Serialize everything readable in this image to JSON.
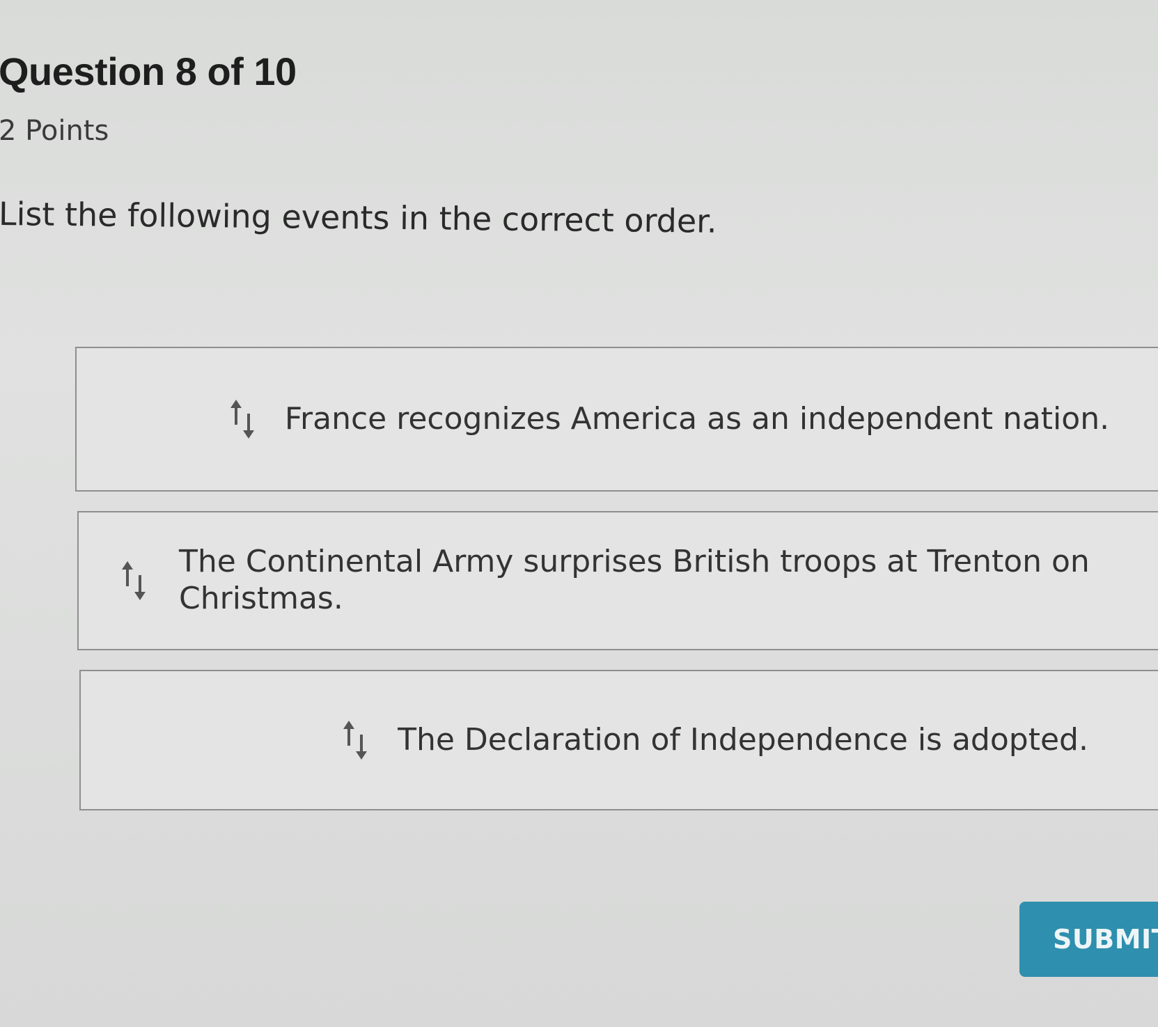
{
  "question": {
    "title": "Question 8 of 10",
    "points": "2 Points",
    "prompt": "List the following events in the correct order."
  },
  "order_items": [
    {
      "label": "France recognizes America as an independent nation.",
      "icon": "reorder-arrows-icon"
    },
    {
      "label": "The Continental Army surprises British troops at Trenton on Christmas.",
      "icon": "reorder-arrows-icon"
    },
    {
      "label": "The Declaration of Independence is adopted.",
      "icon": "reorder-arrows-icon"
    }
  ],
  "actions": {
    "submit_label": "SUBMIT"
  },
  "colors": {
    "submit_bg": "#2f8fae",
    "background": "#dedfde",
    "item_border": "#8d8f8d"
  }
}
